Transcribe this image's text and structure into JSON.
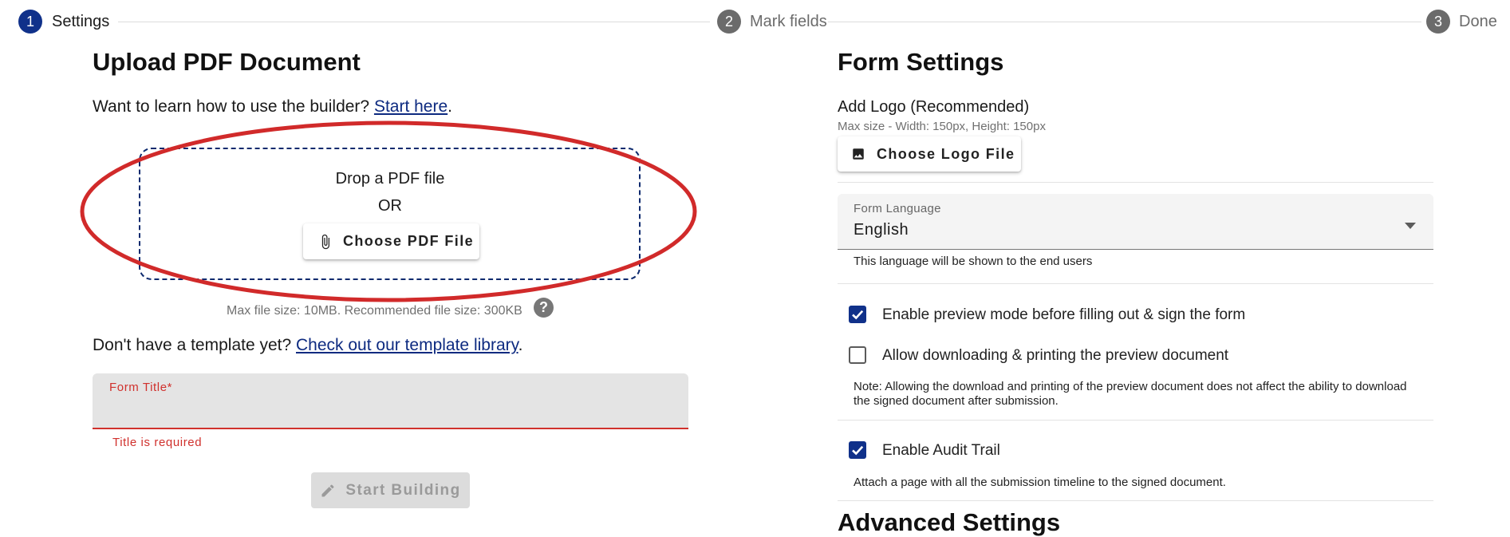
{
  "stepper": {
    "steps": [
      {
        "number": "1",
        "label": "Settings"
      },
      {
        "number": "2",
        "label": "Mark fields"
      },
      {
        "number": "3",
        "label": "Done"
      }
    ],
    "active_color": "#10318a",
    "inactive_color": "#6b6b6b"
  },
  "upload": {
    "heading": "Upload PDF Document",
    "learn_text": "Want to learn how to use the builder? ",
    "learn_link": "Start here",
    "learn_suffix": ".",
    "drop_text": "Drop a PDF file",
    "or_text": "OR",
    "choose_pdf_label": "Choose PDF File",
    "file_hint": "Max file size: 10MB. Recommended file size: 300KB",
    "help_icon_glyph": "?",
    "template_text": "Don't have a template yet? ",
    "template_link": "Check out our template library",
    "template_suffix": ".",
    "form_title_label": "Form Title*",
    "form_title_value": "",
    "form_title_error": "Title is required",
    "start_building_label": "Start Building"
  },
  "settings": {
    "heading": "Form Settings",
    "logo_label": "Add Logo (Recommended)",
    "logo_hint": "Max size - Width: 150px, Height: 150px",
    "choose_logo_label": "Choose Logo File",
    "language_label": "Form Language",
    "language_value": "English",
    "language_helper": "This language will be shown to the end users",
    "preview_mode_label": "Enable preview mode before filling out & sign the form",
    "preview_mode_checked": true,
    "allow_download_label": "Allow downloading & printing the preview document",
    "allow_download_checked": false,
    "download_note": "Note: Allowing the download and printing of the preview document does not affect the ability to download the signed document after submission.",
    "audit_trail_label": "Enable Audit Trail",
    "audit_trail_checked": true,
    "audit_trail_note": "Attach a page with all the submission timeline to the signed document.",
    "advanced_heading": "Advanced Settings"
  },
  "annotation": {
    "color": "#d12a2a",
    "shape": "ellipse"
  },
  "colors": {
    "accent": "#10318a",
    "link": "#0d2a80",
    "error": "#d0312d"
  }
}
